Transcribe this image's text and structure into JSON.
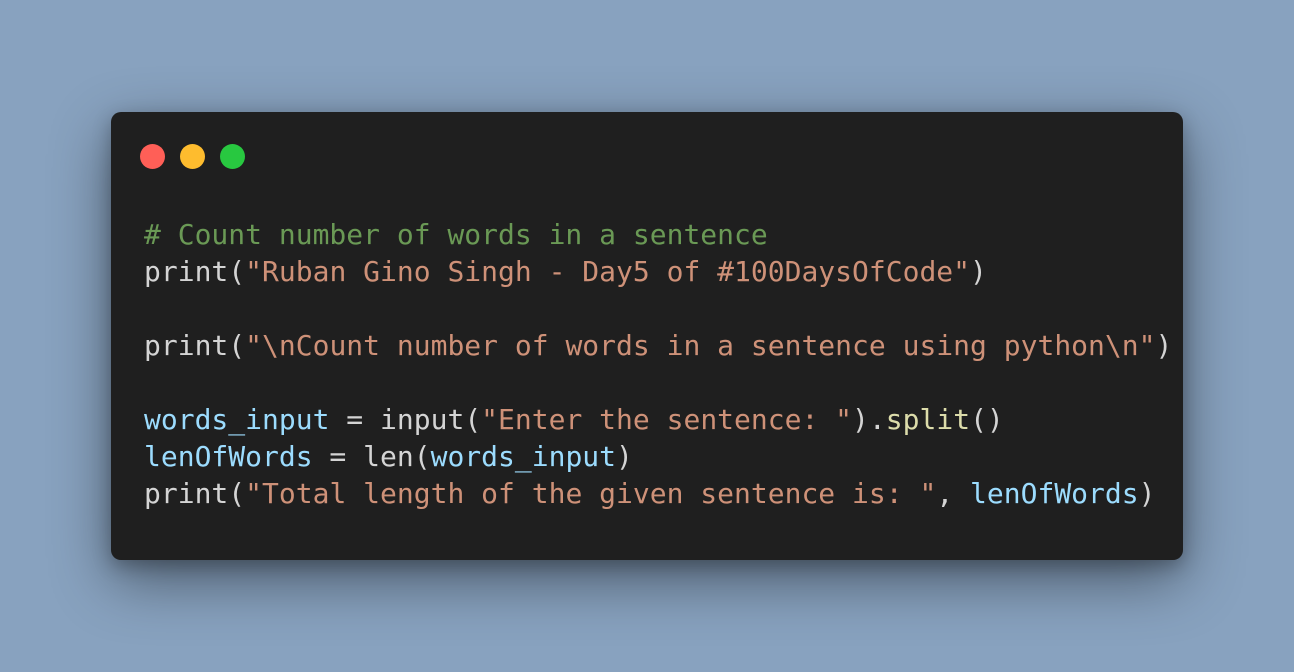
{
  "code_lines": [
    [
      {
        "t": "# Count number of words in a sentence",
        "k": "comment"
      }
    ],
    [
      {
        "t": "print",
        "k": "func"
      },
      {
        "t": "(",
        "k": "punc"
      },
      {
        "t": "\"Ruban Gino Singh - Day5 of #100DaysOfCode\"",
        "k": "string"
      },
      {
        "t": ")",
        "k": "punc"
      }
    ],
    [],
    [
      {
        "t": "print",
        "k": "func"
      },
      {
        "t": "(",
        "k": "punc"
      },
      {
        "t": "\"\\nCount number of words in a sentence using python\\n\"",
        "k": "string"
      },
      {
        "t": ")",
        "k": "punc"
      }
    ],
    [],
    [
      {
        "t": "words_input",
        "k": "var"
      },
      {
        "t": " = ",
        "k": "op"
      },
      {
        "t": "input",
        "k": "func"
      },
      {
        "t": "(",
        "k": "punc"
      },
      {
        "t": "\"Enter the sentence: \"",
        "k": "string"
      },
      {
        "t": ").",
        "k": "punc"
      },
      {
        "t": "split",
        "k": "method"
      },
      {
        "t": "()",
        "k": "punc"
      }
    ],
    [
      {
        "t": "lenOfWords",
        "k": "var"
      },
      {
        "t": " = ",
        "k": "op"
      },
      {
        "t": "len",
        "k": "func"
      },
      {
        "t": "(",
        "k": "punc"
      },
      {
        "t": "words_input",
        "k": "var"
      },
      {
        "t": ")",
        "k": "punc"
      }
    ],
    [
      {
        "t": "print",
        "k": "func"
      },
      {
        "t": "(",
        "k": "punc"
      },
      {
        "t": "\"Total length of the given sentence is: \"",
        "k": "string"
      },
      {
        "t": ", ",
        "k": "punc"
      },
      {
        "t": "lenOfWords",
        "k": "var"
      },
      {
        "t": ")",
        "k": "punc"
      }
    ]
  ],
  "colors": {
    "background": "#88a2bf",
    "window": "#1f1f1f",
    "close": "#ff5f57",
    "minimize": "#febc2e",
    "maximize": "#28c840",
    "comment": "#6a9955",
    "string": "#ce9178",
    "variable": "#9cdcfe",
    "method": "#dcdcaa",
    "default": "#d4d4d4"
  }
}
